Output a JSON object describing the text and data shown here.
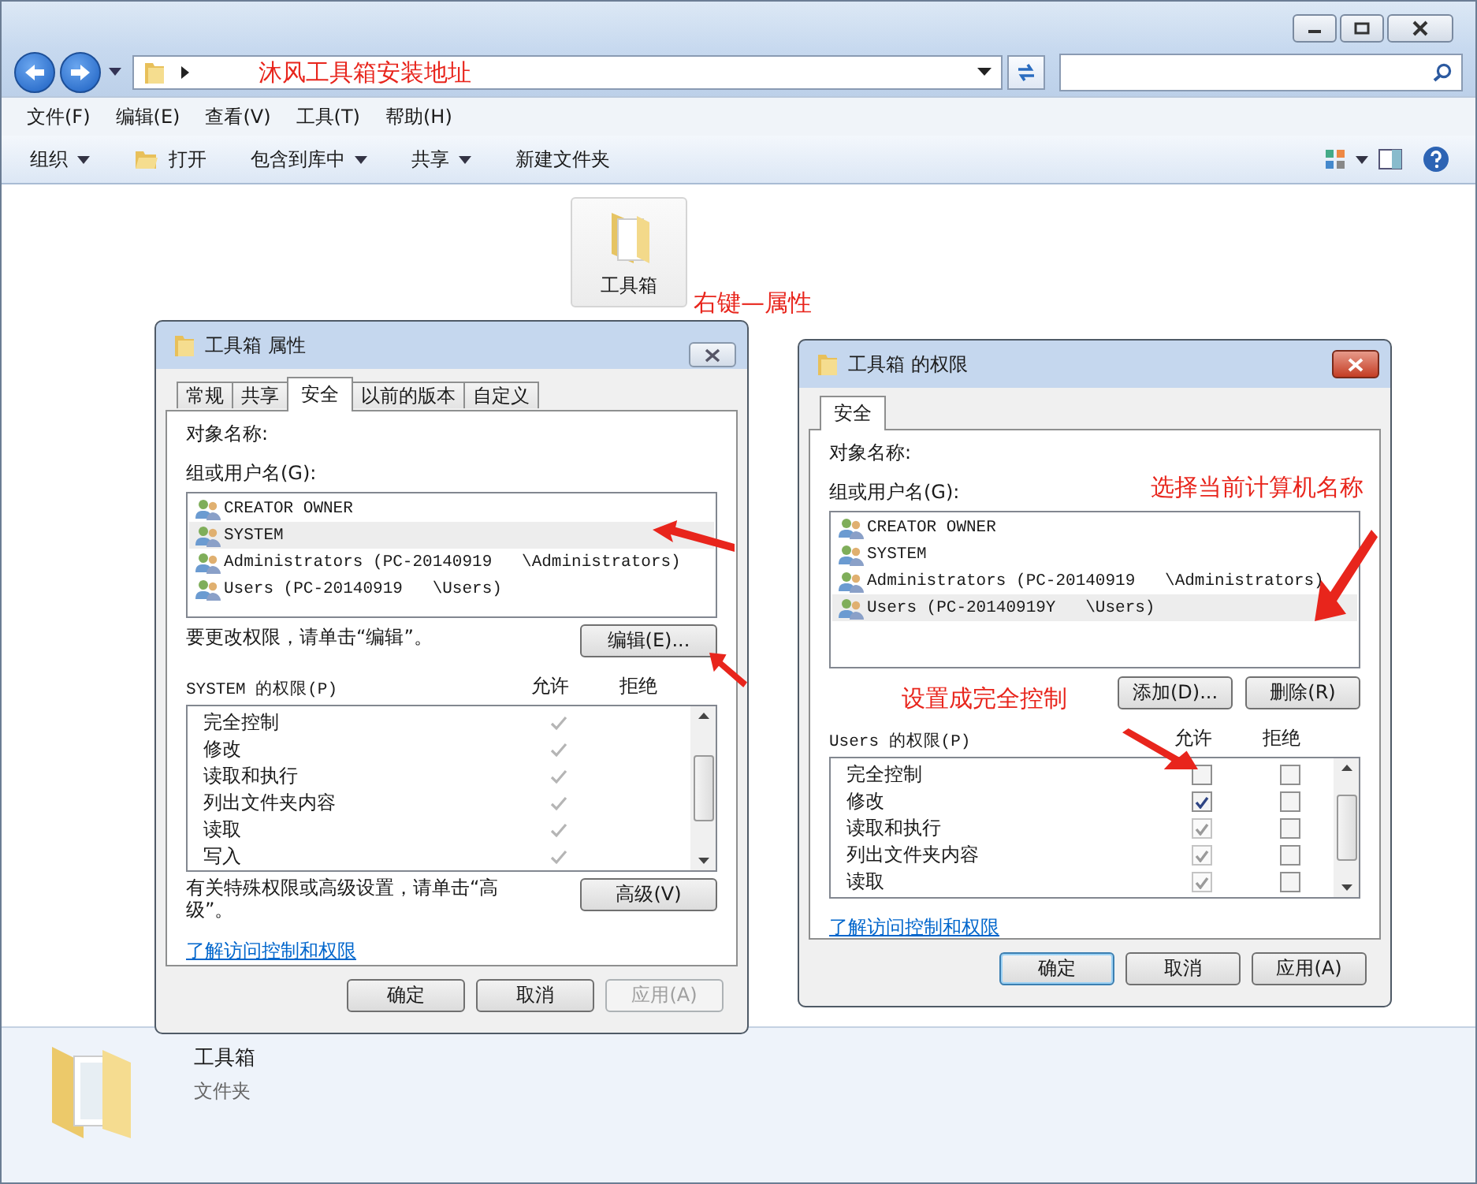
{
  "address_bar": {
    "annotation": "沐风工具箱安装地址"
  },
  "menu": [
    "文件(F)",
    "编辑(E)",
    "查看(V)",
    "工具(T)",
    "帮助(H)"
  ],
  "toolbar": [
    {
      "label": "组织",
      "kind": "menu"
    },
    {
      "label": "打开",
      "kind": "icon"
    },
    {
      "label": "包含到库中",
      "kind": "menu"
    },
    {
      "label": "共享",
      "kind": "menu"
    },
    {
      "label": "新建文件夹",
      "kind": "plain"
    }
  ],
  "folder_item": {
    "name": "工具箱",
    "annotation": "右键—属性"
  },
  "properties_dialog": {
    "title": "工具箱 属性",
    "tabs": [
      {
        "label": "常规",
        "selected": false
      },
      {
        "label": "共享",
        "selected": false
      },
      {
        "label": "安全",
        "selected": true
      },
      {
        "label": "以前的版本",
        "selected": false
      },
      {
        "label": "自定义",
        "selected": false
      }
    ],
    "object_name_label": "对象名称:",
    "groups_label": "组或用户名(G):",
    "groups": [
      {
        "name": "CREATOR OWNER",
        "selected": false
      },
      {
        "name": "SYSTEM",
        "selected": true
      },
      {
        "name": "Administrators (PC-20140919   \\Administrators)",
        "selected": false
      },
      {
        "name": "Users (PC-20140919   \\Users)",
        "selected": false
      }
    ],
    "edit_hint": "要更改权限，请单击“编辑”。",
    "edit_button": "编辑(E)...",
    "permissions_label": "SYSTEM 的权限(P)",
    "allow_header": "允许",
    "deny_header": "拒绝",
    "permissions": [
      {
        "name": "完全控制",
        "allow": true
      },
      {
        "name": "修改",
        "allow": true
      },
      {
        "name": "读取和执行",
        "allow": true
      },
      {
        "name": "列出文件夹内容",
        "allow": true
      },
      {
        "name": "读取",
        "allow": true
      },
      {
        "name": "写入",
        "allow": true
      }
    ],
    "advanced_hint": "有关特殊权限或高级设置，请单击“高级”。",
    "advanced_button": "高级(V)",
    "link": "了解访问控制和权限",
    "buttons": [
      {
        "label": "确定",
        "disabled": false
      },
      {
        "label": "取消",
        "disabled": false
      },
      {
        "label": "应用(A)",
        "disabled": true
      }
    ]
  },
  "permissions_dialog": {
    "title": "工具箱 的权限",
    "tabs": [
      {
        "label": "安全",
        "selected": true
      }
    ],
    "object_name_label": "对象名称:",
    "groups_label": "组或用户名(G):",
    "groups_annotation": "选择当前计算机名称",
    "groups": [
      {
        "name": "CREATOR OWNER",
        "selected": false
      },
      {
        "name": "SYSTEM",
        "selected": false
      },
      {
        "name": "Administrators (PC-20140919   \\Administrators)",
        "selected": false
      },
      {
        "name": "Users (PC-20140919Y   \\Users)",
        "selected": true
      }
    ],
    "add_button": "添加(D)...",
    "remove_button": "删除(R)",
    "permissions_annotation": "设置成完全控制",
    "permissions_label": "Users 的权限(P)",
    "allow_header": "允许",
    "deny_header": "拒绝",
    "permissions": [
      {
        "name": "完全控制",
        "allow": false,
        "disabled": false,
        "deny": false
      },
      {
        "name": "修改",
        "allow": true,
        "disabled": false,
        "deny": false
      },
      {
        "name": "读取和执行",
        "allow": true,
        "disabled": true,
        "deny": false
      },
      {
        "name": "列出文件夹内容",
        "allow": true,
        "disabled": true,
        "deny": false
      },
      {
        "name": "读取",
        "allow": true,
        "disabled": true,
        "deny": false
      }
    ],
    "link": "了解访问控制和权限",
    "buttons": [
      {
        "label": "确定",
        "default": true
      },
      {
        "label": "取消",
        "default": false
      },
      {
        "label": "应用(A)",
        "default": false
      }
    ]
  },
  "details_pane": {
    "name": "工具箱",
    "type": "文件夹"
  }
}
